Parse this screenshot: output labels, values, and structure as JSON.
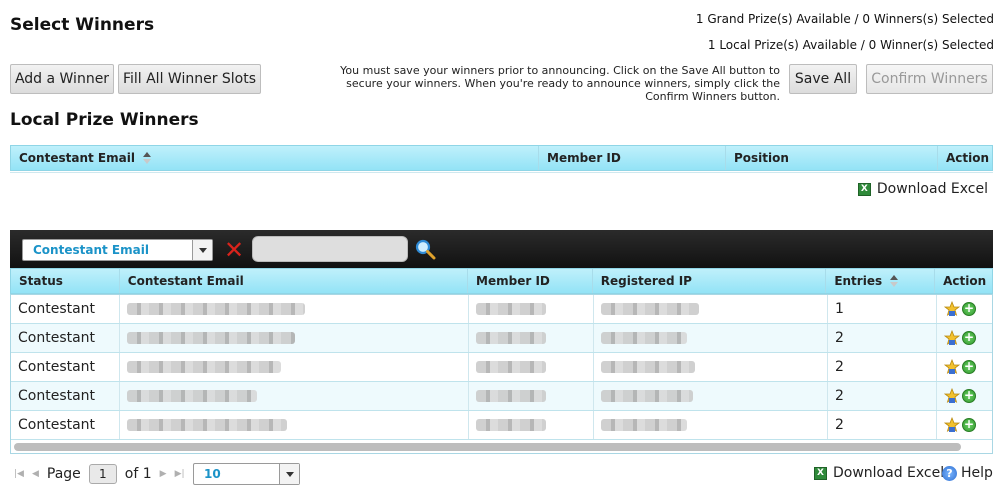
{
  "page": {
    "title": "Select Winners",
    "grand_prize_info": "1 Grand Prize(s) Available / 0 Winners(s) Selected",
    "local_prize_info": "1 Local Prize(s) Available / 0 Winner(s) Selected",
    "add_winner_label": "Add a Winner",
    "fill_slots_label": "Fill All Winner Slots",
    "notice": "You must save your winners prior to announcing. Click on the Save All button to secure your winners. When you're ready to announce winners, simply click the Confirm Winners button.",
    "save_all_label": "Save All",
    "confirm_label": "Confirm Winners"
  },
  "winners": {
    "section_title": "Local Prize Winners",
    "columns": [
      "Contestant Email",
      "Member ID",
      "Position",
      "Action"
    ],
    "download_label": "Download Excel"
  },
  "filter": {
    "field_selected": "Contestant Email"
  },
  "contestants": {
    "columns": [
      "Status",
      "Contestant Email",
      "Member ID",
      "Registered IP",
      "Entries",
      "Action"
    ],
    "rows": [
      {
        "status": "Contestant",
        "entries": "1"
      },
      {
        "status": "Contestant",
        "entries": "2"
      },
      {
        "status": "Contestant",
        "entries": "2"
      },
      {
        "status": "Contestant",
        "entries": "2"
      },
      {
        "status": "Contestant",
        "entries": "2"
      }
    ]
  },
  "pager": {
    "page_label": "Page",
    "page_value": "1",
    "of_label": "of 1",
    "page_size": "10",
    "download_label": "Download Excel",
    "help_label": "Help"
  },
  "icons": {
    "first": "first-page-icon",
    "prev": "prev-page-icon",
    "next": "next-page-icon",
    "last": "last-page-icon",
    "excel": "excel-icon",
    "clear": "clear-filter-icon",
    "search": "search-icon",
    "award": "award-icon",
    "add": "add-circle-icon",
    "help": "help-icon"
  },
  "colors": {
    "header_bg": "#a6e8f8",
    "toolbar_bg": "#1a1a1a",
    "accent": "#1b93c8",
    "clear_red": "#d9231c"
  }
}
